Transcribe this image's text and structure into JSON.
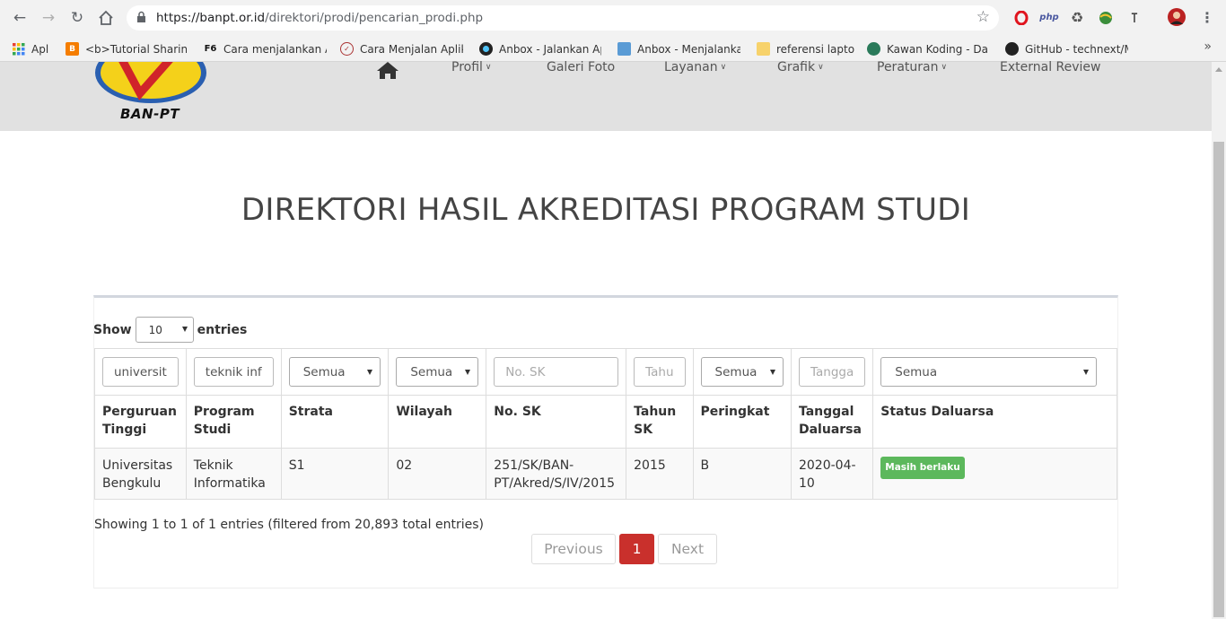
{
  "browser": {
    "url_host": "https://banpt.or.id",
    "url_path": "/direktori/prodi/pencarian_prodi.php",
    "bookmarks": [
      {
        "label": "Apl",
        "icon": "apps-grid-icon"
      },
      {
        "label": "<b>Tutorial Sharing",
        "icon": "blogger-icon"
      },
      {
        "label": "Cara menjalankan Ap",
        "icon": "f6-icon"
      },
      {
        "label": "Cara Menjalan Aplika",
        "icon": "site-logo-icon"
      },
      {
        "label": "Anbox - Jalankan Apl",
        "icon": "anbox-icon"
      },
      {
        "label": "Anbox - Menjalankan",
        "icon": "image-icon"
      },
      {
        "label": "referensi laptop",
        "icon": "folder-icon"
      },
      {
        "label": "Kawan Koding - Dafta",
        "icon": "kawan-koding-icon"
      },
      {
        "label": "GitHub - technext/M",
        "icon": "github-icon"
      }
    ],
    "extensions": [
      "opera-icon",
      "php-icon",
      "recycle-icon",
      "globe-icon",
      "person-icon",
      "avatar",
      "menu-dots-icon"
    ]
  },
  "header": {
    "logo_text": "BAN-PT",
    "menu": [
      {
        "label": "Profil",
        "dropdown": true
      },
      {
        "label": "Galeri Foto",
        "dropdown": false
      },
      {
        "label": "Layanan",
        "dropdown": true
      },
      {
        "label": "Grafik",
        "dropdown": true
      },
      {
        "label": "Peraturan",
        "dropdown": true
      },
      {
        "label": "External Review",
        "dropdown": false
      }
    ]
  },
  "page_title": "DIREKTORI HASIL AKREDITASI PROGRAM STUDI",
  "table": {
    "show_label": "Show",
    "entries_label": "entries",
    "page_length": "10",
    "filters": [
      {
        "type": "input",
        "value": "universit"
      },
      {
        "type": "input",
        "value": "teknik inf"
      },
      {
        "type": "select",
        "value": "Semua"
      },
      {
        "type": "select",
        "value": "Semua"
      },
      {
        "type": "input",
        "placeholder": "No. SK"
      },
      {
        "type": "input",
        "placeholder": "Tahu"
      },
      {
        "type": "select",
        "value": "Semua"
      },
      {
        "type": "input",
        "placeholder": "Tangga"
      },
      {
        "type": "select",
        "value": "Semua"
      }
    ],
    "columns": [
      {
        "l1": "Perguruan",
        "l2": "Tinggi"
      },
      {
        "l1": "Program",
        "l2": "Studi"
      },
      {
        "l1": "",
        "l2": "Strata"
      },
      {
        "l1": "",
        "l2": "Wilayah"
      },
      {
        "l1": "",
        "l2": "No. SK"
      },
      {
        "l1": "Tahun",
        "l2": "SK"
      },
      {
        "l1": "",
        "l2": "Peringkat"
      },
      {
        "l1": "Tanggal",
        "l2": "Daluarsa"
      },
      {
        "l1": "",
        "l2": "Status Daluarsa"
      }
    ],
    "rows": [
      {
        "perguruan_tinggi": [
          "Universitas",
          "Bengkulu"
        ],
        "program_studi": [
          "Teknik",
          "Informatika"
        ],
        "strata": "S1",
        "wilayah": "02",
        "no_sk": [
          "251/SK/BAN-",
          "PT/Akred/S/IV/2015"
        ],
        "tahun_sk": "2015",
        "peringkat": "B",
        "tanggal_daluarsa": [
          "2020-04-",
          "10"
        ],
        "status": "Masih berlaku",
        "status_color": "#5cb85c"
      }
    ],
    "info": "Showing 1 to 1 of 1 entries (filtered from 20,893 total entries)",
    "pagination": {
      "previous": "Previous",
      "current": "1",
      "next": "Next"
    }
  },
  "colors": {
    "accent": "#c9302c",
    "header_bg": "#e1e1e1"
  }
}
